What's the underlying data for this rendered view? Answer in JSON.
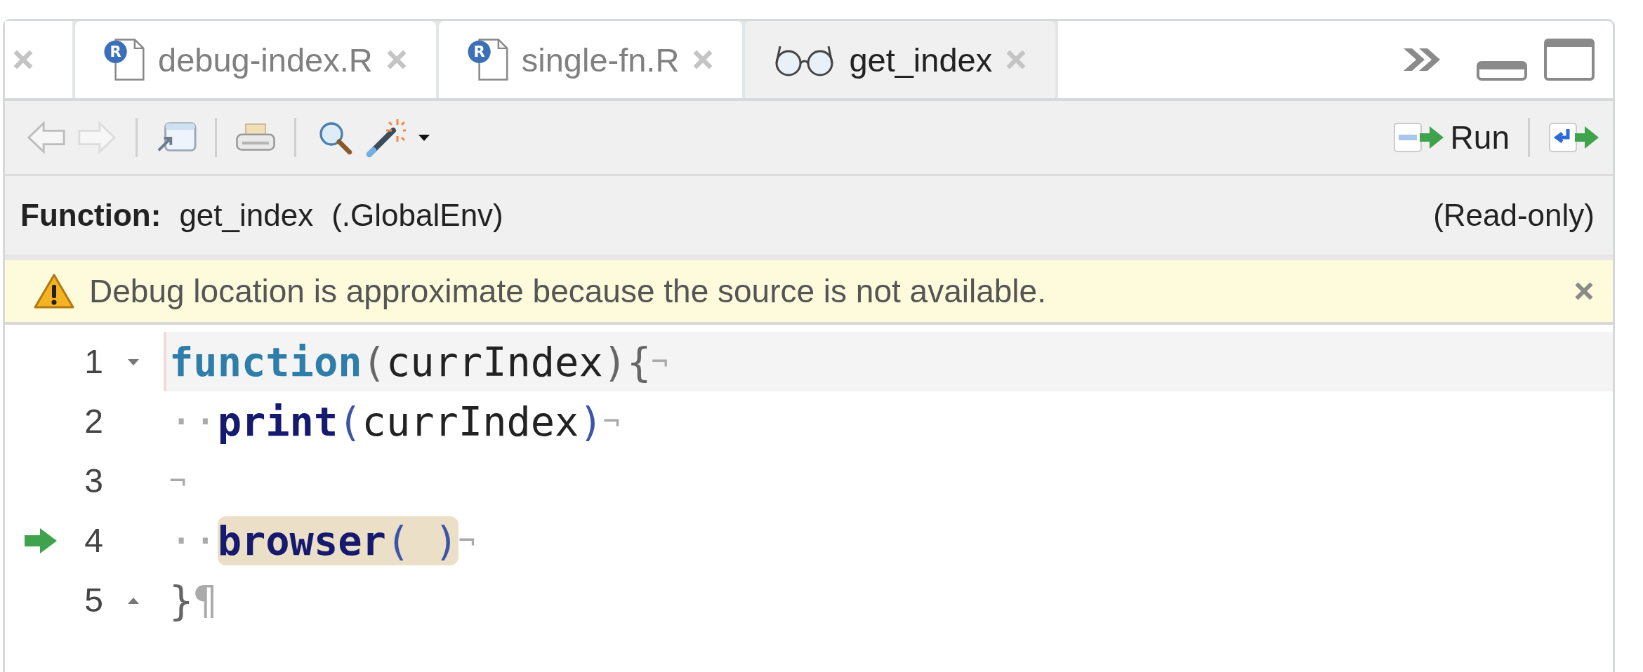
{
  "tabs": [
    {
      "label": "debug-index.R",
      "kind": "r-script",
      "icon_letter": "R",
      "selected": false
    },
    {
      "label": "single-fn.R",
      "kind": "r-script",
      "icon_letter": "R",
      "selected": false
    },
    {
      "label": "get_index",
      "kind": "function-view",
      "selected": true
    }
  ],
  "toolbar": {
    "run_label": "Run"
  },
  "info": {
    "label": "Function:",
    "name": "get_index",
    "env": "(.GlobalEnv)",
    "mode": "(Read-only)"
  },
  "warning": {
    "message": "Debug location is approximate because the source is not available.",
    "dismissible": true
  },
  "editor": {
    "lines": [
      {
        "number": "1",
        "kind": "fold-start",
        "cursor": true,
        "current": false,
        "tokens": [
          {
            "kind": "keyword",
            "text": "function"
          },
          {
            "kind": "paren_dim",
            "text": "("
          },
          {
            "kind": "ident",
            "text": "currIndex"
          },
          {
            "kind": "paren_dim",
            "text": ")"
          },
          {
            "kind": "paren_dim",
            "text": "{"
          },
          {
            "kind": "eol",
            "text": "¬"
          }
        ]
      },
      {
        "number": "2",
        "kind": "plain",
        "cursor": false,
        "current": false,
        "tokens": [
          {
            "kind": "ws",
            "text": "··"
          },
          {
            "kind": "builtin",
            "text": "print"
          },
          {
            "kind": "paren_match",
            "text": "("
          },
          {
            "kind": "ident",
            "text": "currIndex"
          },
          {
            "kind": "paren_match",
            "text": ")"
          },
          {
            "kind": "eol",
            "text": "¬"
          }
        ]
      },
      {
        "number": "3",
        "kind": "plain",
        "cursor": false,
        "current": false,
        "tokens": [
          {
            "kind": "eol",
            "text": "¬"
          }
        ]
      },
      {
        "number": "4",
        "kind": "plain",
        "cursor": false,
        "current": true,
        "tokens": [
          {
            "kind": "ws",
            "text": "··"
          },
          {
            "kind": "highlight",
            "children": [
              {
                "kind": "builtin",
                "text": "browser"
              },
              {
                "kind": "paren_match",
                "text": "( )"
              }
            ]
          },
          {
            "kind": "eol",
            "text": "¬"
          }
        ]
      },
      {
        "number": "5",
        "kind": "fold-end",
        "cursor": false,
        "current": false,
        "tokens": [
          {
            "kind": "paren_dim",
            "text": "}"
          },
          {
            "kind": "eof",
            "text": "¶"
          }
        ]
      }
    ]
  }
}
